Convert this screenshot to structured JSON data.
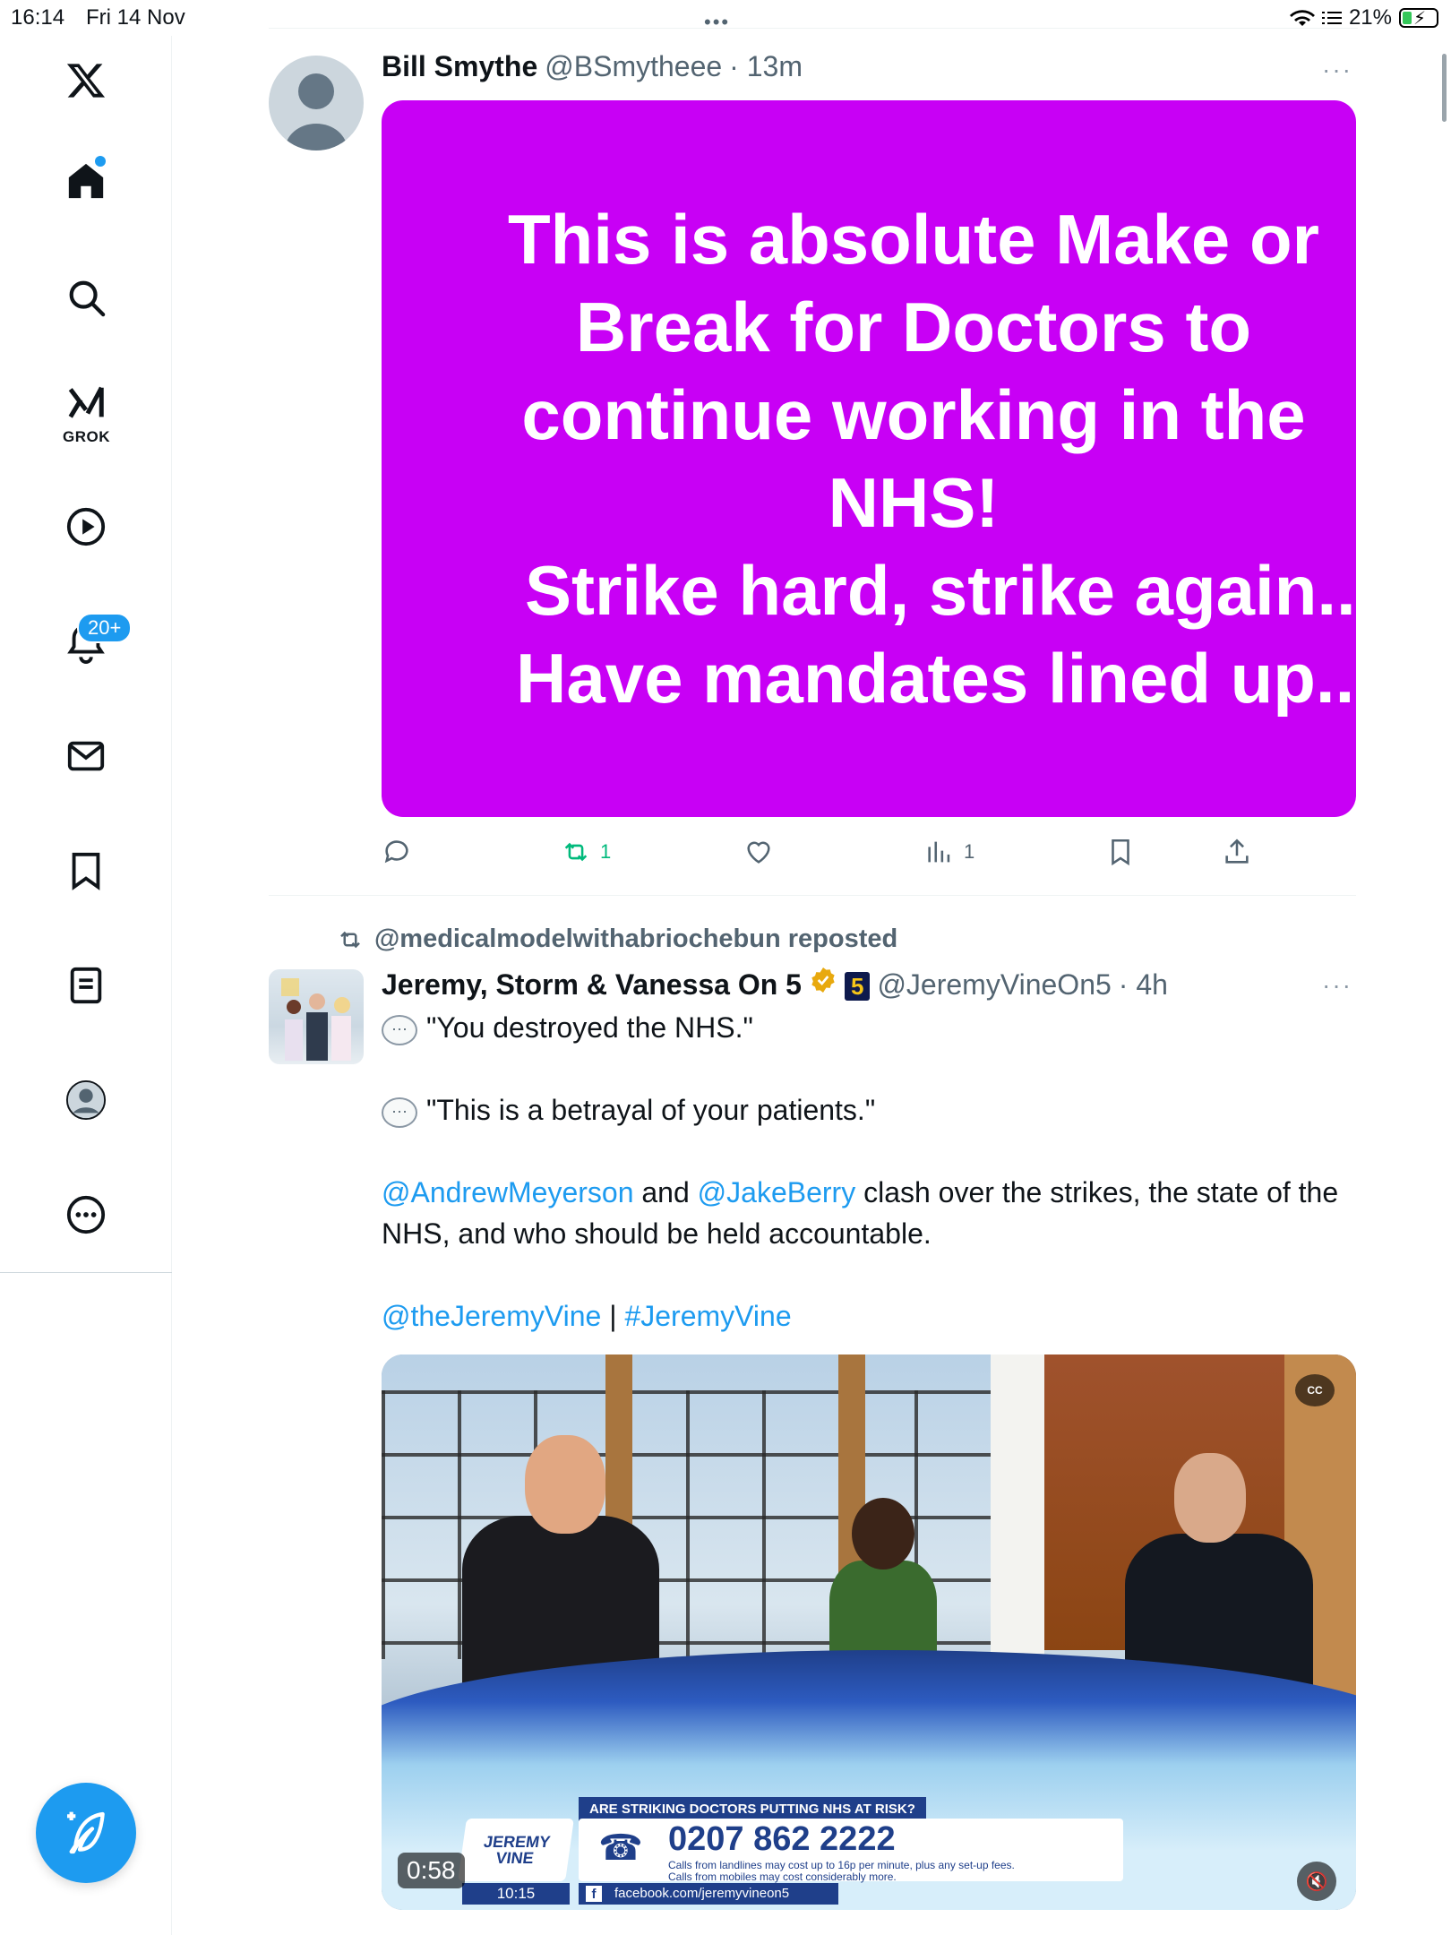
{
  "status_bar": {
    "time": "16:14",
    "date": "Fri 14 Nov",
    "battery": "21%"
  },
  "sidebar": {
    "items": [
      {
        "name": "x-logo-icon"
      },
      {
        "name": "home-icon"
      },
      {
        "name": "search-icon"
      },
      {
        "name": "grok-icon",
        "label": "GROK"
      },
      {
        "name": "video-icon"
      },
      {
        "name": "notifications-icon",
        "badge": "20+"
      },
      {
        "name": "messages-icon"
      },
      {
        "name": "bookmarks-icon"
      },
      {
        "name": "lists-icon"
      },
      {
        "name": "profile-icon"
      },
      {
        "name": "more-icon"
      }
    ],
    "compose_icon": "compose-plus-feather-icon"
  },
  "feed": {
    "tweet1": {
      "name": "Bill Smythe",
      "handle": "@BSmytheee",
      "time": "· 13m",
      "image_lines": [
        "This is absolute Make or",
        "Break for Doctors to",
        "continue working in the",
        "NHS!",
        "Strike hard, strike again...",
        "Have mandates lined up..."
      ],
      "image_bg": "#c800f5",
      "retweets": "1",
      "views": "1"
    },
    "tweet2": {
      "reposted_by": "@medicalmodelwithabriochebun reposted",
      "name": "Jeremy, Storm & Vanessa On 5",
      "channel_badge": "5",
      "handle": "@JeremyVineOn5",
      "time": "· 4h",
      "quote1": "\"You destroyed the NHS.\"",
      "quote2": "\"This is a betrayal of your patients.\"",
      "mention1": "@AndrewMeyerson",
      "and_text": " and ",
      "mention2": "@JakeBerry",
      "body_text": " clash over the strikes, the state of the NHS, and who should be held accountable.",
      "tag1": "@theJeremyVine",
      "sep": " | ",
      "tag2": "#JeremyVine",
      "video": {
        "headline": "ARE STRIKING DOCTORS PUTTING NHS AT RISK?",
        "logo": "JEREMY VINE",
        "phone": "0207 862 2222",
        "small1": "Calls from landlines may cost up to 16p per minute, plus any set-up fees.",
        "small2": "Calls from mobiles may cost considerably more.",
        "clock": "10:15",
        "facebook": "facebook.com/jeremyvineon5",
        "duration": "0:58",
        "cc": "CC"
      }
    }
  },
  "colors": {
    "accent": "#1d9bf0",
    "retweet_green": "#00ba7c",
    "muted": "#536471"
  }
}
